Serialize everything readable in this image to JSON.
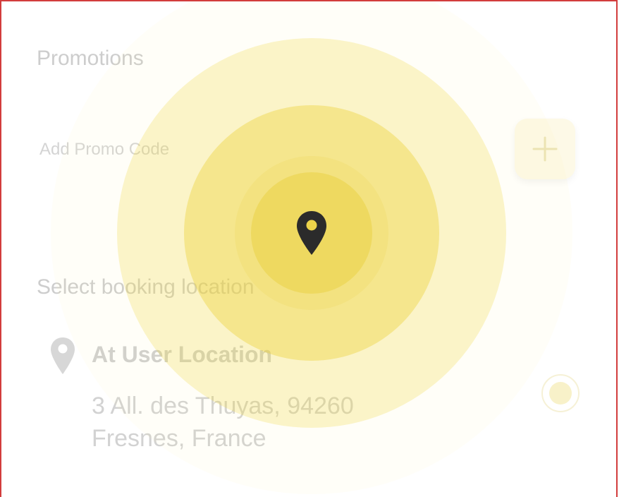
{
  "promotions": {
    "title": "Promotions",
    "promo_placeholder": "Add Promo Code",
    "add_icon": "plus-icon"
  },
  "booking": {
    "title": "Select booking location",
    "location": {
      "icon": "map-pin-icon",
      "name": "At User Location",
      "address": "3 All. des Thuyas, 94260 Fresnes, France"
    }
  },
  "overlay": {
    "icon": "map-pin-icon",
    "accent": "#ecd34a"
  }
}
